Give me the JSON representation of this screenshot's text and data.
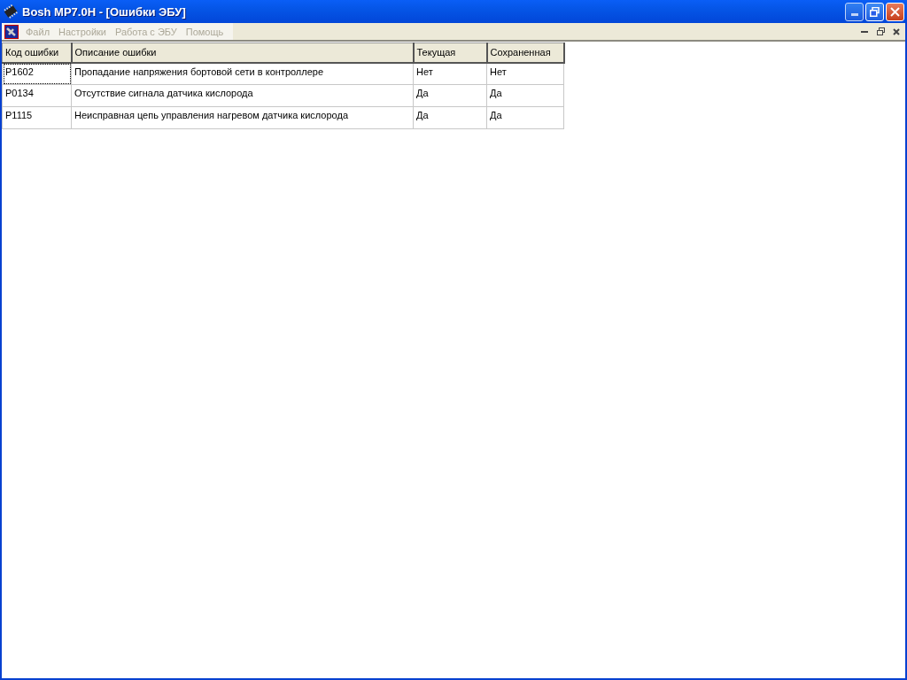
{
  "window": {
    "title": "Bosh MP7.0H - [Ошибки ЭБУ]"
  },
  "menu": [
    {
      "label": "Файл",
      "disabled": true
    },
    {
      "label": "Настройки",
      "disabled": true
    },
    {
      "label": "Работа с ЭБУ",
      "disabled": true
    },
    {
      "label": "Помощь",
      "disabled": true
    }
  ],
  "table": {
    "columns": [
      "Код ошибки",
      "Описание ошибки",
      "Текущая",
      "Сохраненная"
    ],
    "rows": [
      {
        "cells": [
          "P1602",
          "Пропадание напряжения бортовой сети в контроллере",
          "Нет",
          "Нет"
        ],
        "focused": true
      },
      {
        "cells": [
          "P0134",
          "Отсутствие сигнала датчика кислорода",
          "Да",
          "Да"
        ],
        "focused": false
      },
      {
        "cells": [
          "P1115",
          "Неисправная цепь управления нагревом датчика кислорода",
          "Да",
          "Да"
        ],
        "focused": false
      }
    ]
  }
}
